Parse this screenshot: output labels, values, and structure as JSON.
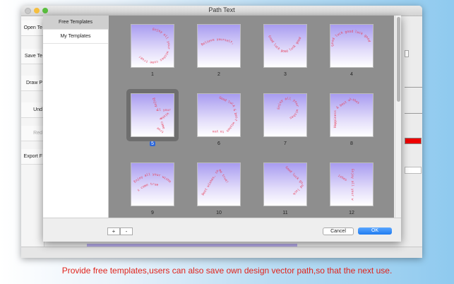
{
  "window": {
    "title": "Path Text",
    "left_buttons": [
      "Open Te",
      "Save Te",
      "Draw P",
      "Und",
      "Red",
      "Export F"
    ]
  },
  "sidebar": {
    "items": [
      {
        "label": "Free Templates",
        "active": true
      },
      {
        "label": "My Templates",
        "active": false
      }
    ]
  },
  "templates": [
    {
      "number": "1",
      "text": "Enjoy all your wishes come true!",
      "shape": "circle"
    },
    {
      "number": "2",
      "text": "Believe yourself, give us trust",
      "shape": "arc-top"
    },
    {
      "number": "3",
      "text": "Good luck good luck good luck",
      "shape": "arc-bottom"
    },
    {
      "number": "4",
      "text": "Good luck good luck good",
      "shape": "ellipse"
    },
    {
      "number": "5",
      "text": "Enjoy all your wishes come true",
      "shape": "star",
      "selected": true
    },
    {
      "number": "6",
      "text": "Good luck & best wishes to you",
      "shape": "heptagon"
    },
    {
      "number": "7",
      "text": "Enjoy all your wishes",
      "shape": "question"
    },
    {
      "number": "8",
      "text": "Happiness & best wishes",
      "shape": "house"
    },
    {
      "number": "9",
      "text": "Enjoy all your wishes come true",
      "shape": "wave"
    },
    {
      "number": "10",
      "text": "Best wishes, come true!",
      "shape": "triangle"
    },
    {
      "number": "11",
      "text": "Good luck good luck",
      "shape": "diamond"
    },
    {
      "number": "12",
      "text": "Enjoy all your wishes",
      "shape": "asterisk"
    }
  ],
  "footer": {
    "add_label": "+",
    "remove_label": "-",
    "cancel_label": "Cancel",
    "ok_label": "OK"
  },
  "caption": "Provide free templates,users can also save own design vector path,so that the next use.",
  "colors": {
    "path_text": "#e8415a",
    "ok_button": "#1f7cf0",
    "caption_text": "#e0231b",
    "grid_background": "#8e8e8e"
  }
}
